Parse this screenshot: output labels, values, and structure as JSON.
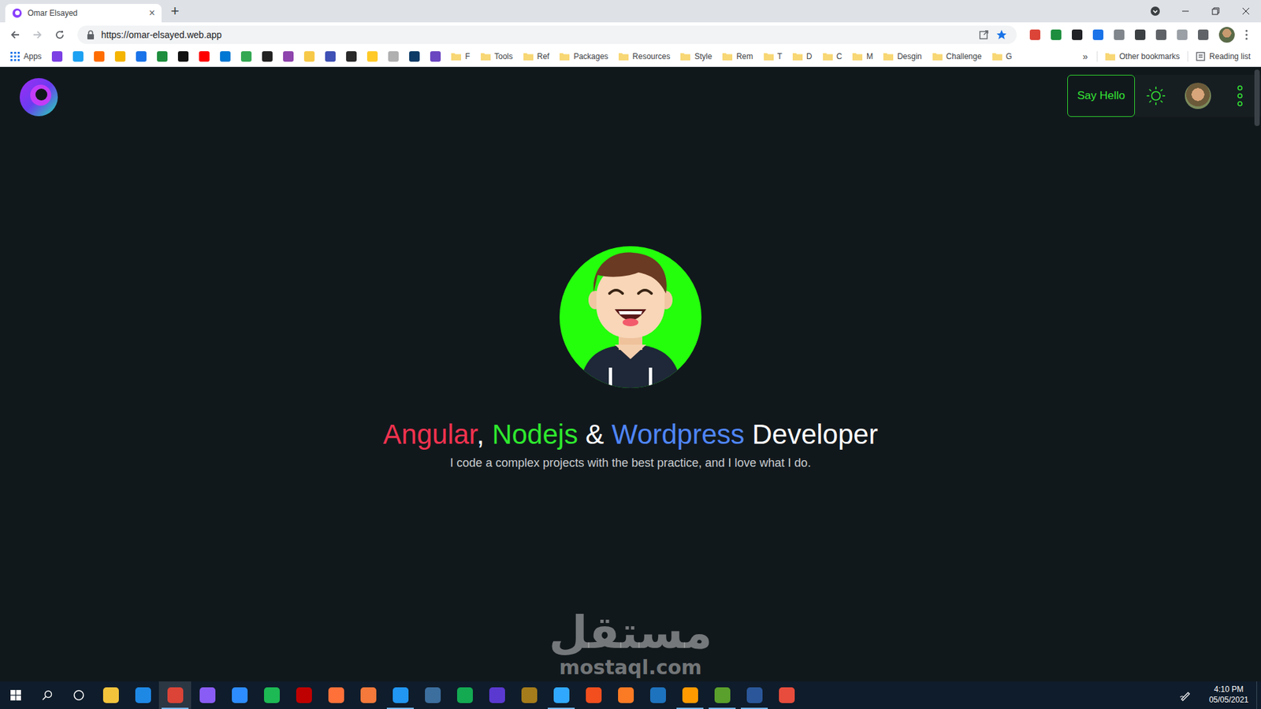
{
  "browser": {
    "tab": {
      "title": "Omar Elsayed",
      "close": "×"
    },
    "new_tab": "+",
    "url": "https://omar-elsayed.web.app",
    "extensions": [
      {
        "color": "#db4437"
      },
      {
        "color": "#1e8e3e"
      },
      {
        "color": "#202124"
      },
      {
        "color": "#1a73e8"
      },
      {
        "color": "#80868b"
      },
      {
        "color": "#3c4043"
      },
      {
        "color": "#5f6368"
      },
      {
        "color": "#9aa0a6"
      },
      {
        "color": "#5f6368"
      }
    ],
    "bookmarks": {
      "apps": "Apps",
      "icons": [
        {
          "color": "#7b3fe4"
        },
        {
          "color": "#1da1f2"
        },
        {
          "color": "#ff6d00"
        },
        {
          "color": "#f4b400"
        },
        {
          "color": "#1a73e8"
        },
        {
          "color": "#1e8e3e"
        },
        {
          "color": "#111111"
        },
        {
          "color": "#ff0000"
        },
        {
          "color": "#0078d4"
        },
        {
          "color": "#34a853"
        },
        {
          "color": "#222222"
        },
        {
          "color": "#8e44ad"
        },
        {
          "color": "#f7c948"
        },
        {
          "color": "#3f51b5"
        },
        {
          "color": "#2a2a2a"
        },
        {
          "color": "#ffca28"
        },
        {
          "color": "#b0b0b0"
        },
        {
          "color": "#0d3b66"
        },
        {
          "color": "#6b46c1"
        }
      ],
      "folders": [
        "F",
        "Tools",
        "Ref",
        "Packages",
        "Resources",
        "Style",
        "Rem",
        "T",
        "D",
        "C",
        "M",
        "Desgin",
        "Challenge",
        "G"
      ],
      "more": "»",
      "other": "Other bookmarks",
      "reading_list": "Reading list"
    }
  },
  "page": {
    "say_hello": "Say Hello",
    "headline": [
      {
        "text": "Angular",
        "color": "#f0324f"
      },
      {
        "text": ", ",
        "color": "#ffffff"
      },
      {
        "text": "Nodejs",
        "color": "#2ee82e"
      },
      {
        "text": " & ",
        "color": "#ffffff"
      },
      {
        "text": "Wordpress",
        "color": "#4f86f7"
      },
      {
        "text": " Developer",
        "color": "#ffffff"
      }
    ],
    "subtitle": "I code a complex projects with the best practice, and I love what I do."
  },
  "taskbar": {
    "apps": [
      {
        "color": "#f3c33c",
        "running": false,
        "selected": false
      },
      {
        "color": "#1e88e5",
        "running": false,
        "selected": false
      },
      {
        "color": "#db4437",
        "running": true,
        "selected": true
      },
      {
        "color": "#8a5cf6",
        "running": false,
        "selected": false
      },
      {
        "color": "#2d8cff",
        "running": false,
        "selected": false
      },
      {
        "color": "#1db954",
        "running": false,
        "selected": false
      },
      {
        "color": "#bf0000",
        "running": false,
        "selected": false
      },
      {
        "color": "#ff7139",
        "running": false,
        "selected": false
      },
      {
        "color": "#f5793a",
        "running": false,
        "selected": false
      },
      {
        "color": "#2196f3",
        "running": true,
        "selected": false
      },
      {
        "color": "#3c6e9e",
        "running": false,
        "selected": false
      },
      {
        "color": "#13aa52",
        "running": false,
        "selected": false
      },
      {
        "color": "#5a39d0",
        "running": false,
        "selected": false
      },
      {
        "color": "#a57c1b",
        "running": false,
        "selected": false
      },
      {
        "color": "#31a8ff",
        "running": true,
        "selected": false
      },
      {
        "color": "#f24e1e",
        "running": false,
        "selected": false
      },
      {
        "color": "#fb7a24",
        "running": false,
        "selected": false
      },
      {
        "color": "#1e73be",
        "running": false,
        "selected": false
      },
      {
        "color": "#ff9a00",
        "running": true,
        "selected": false
      },
      {
        "color": "#5aa02c",
        "running": true,
        "selected": false
      },
      {
        "color": "#2b579a",
        "running": true,
        "selected": false
      },
      {
        "color": "#e74c3c",
        "running": false,
        "selected": false
      }
    ],
    "time": "4:10 PM",
    "date": "05/05/2021"
  },
  "watermark": {
    "arabic": "مستقل",
    "latin": "mostaql.com"
  }
}
